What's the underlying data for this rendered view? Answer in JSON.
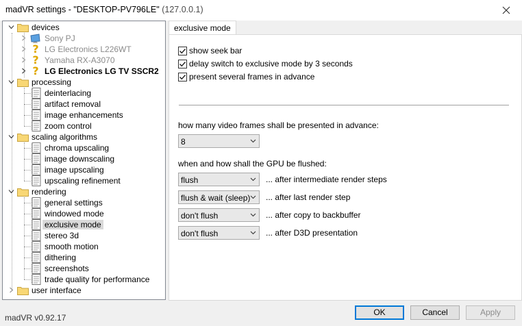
{
  "window": {
    "title_main": "madVR settings - \"DESKTOP-PV796LE\"",
    "title_ip": "(127.0.0.1)",
    "close_icon": "close-icon"
  },
  "tree": {
    "devices": {
      "label": "devices",
      "children": [
        "Sony PJ",
        "LG Electronics L226WT",
        "Yamaha RX-A3070",
        "LG Electronics LG TV SSCR2"
      ]
    },
    "processing": {
      "label": "processing",
      "children": [
        "deinterlacing",
        "artifact removal",
        "image enhancements",
        "zoom control"
      ]
    },
    "scaling": {
      "label": "scaling algorithms",
      "children": [
        "chroma upscaling",
        "image downscaling",
        "image upscaling",
        "upscaling refinement"
      ]
    },
    "rendering": {
      "label": "rendering",
      "children": [
        "general settings",
        "windowed mode",
        "exclusive mode",
        "stereo 3d",
        "smooth motion",
        "dithering",
        "screenshots",
        "trade quality for performance"
      ]
    },
    "ui": {
      "label": "user interface"
    },
    "selected": "exclusive mode"
  },
  "tab": {
    "label": "exclusive mode"
  },
  "options": {
    "show_seek_bar": {
      "label": "show seek bar",
      "checked": true
    },
    "delay_switch": {
      "label": "delay switch to exclusive mode by 3 seconds",
      "checked": true
    },
    "present_frames": {
      "label": "present several frames in advance",
      "checked": true
    }
  },
  "frames": {
    "label": "how many video frames shall be presented in advance:",
    "value": "8"
  },
  "flush": {
    "label": "when and how shall the GPU be flushed:",
    "rows": [
      {
        "value": "flush",
        "after": "... after intermediate render steps"
      },
      {
        "value": "flush & wait (sleep)",
        "after": "... after last render step"
      },
      {
        "value": "don't flush",
        "after": "... after copy to backbuffer"
      },
      {
        "value": "don't flush",
        "after": "... after D3D presentation"
      }
    ]
  },
  "footer": {
    "version": "madVR v0.92.17",
    "ok": "OK",
    "cancel": "Cancel",
    "apply": "Apply"
  }
}
